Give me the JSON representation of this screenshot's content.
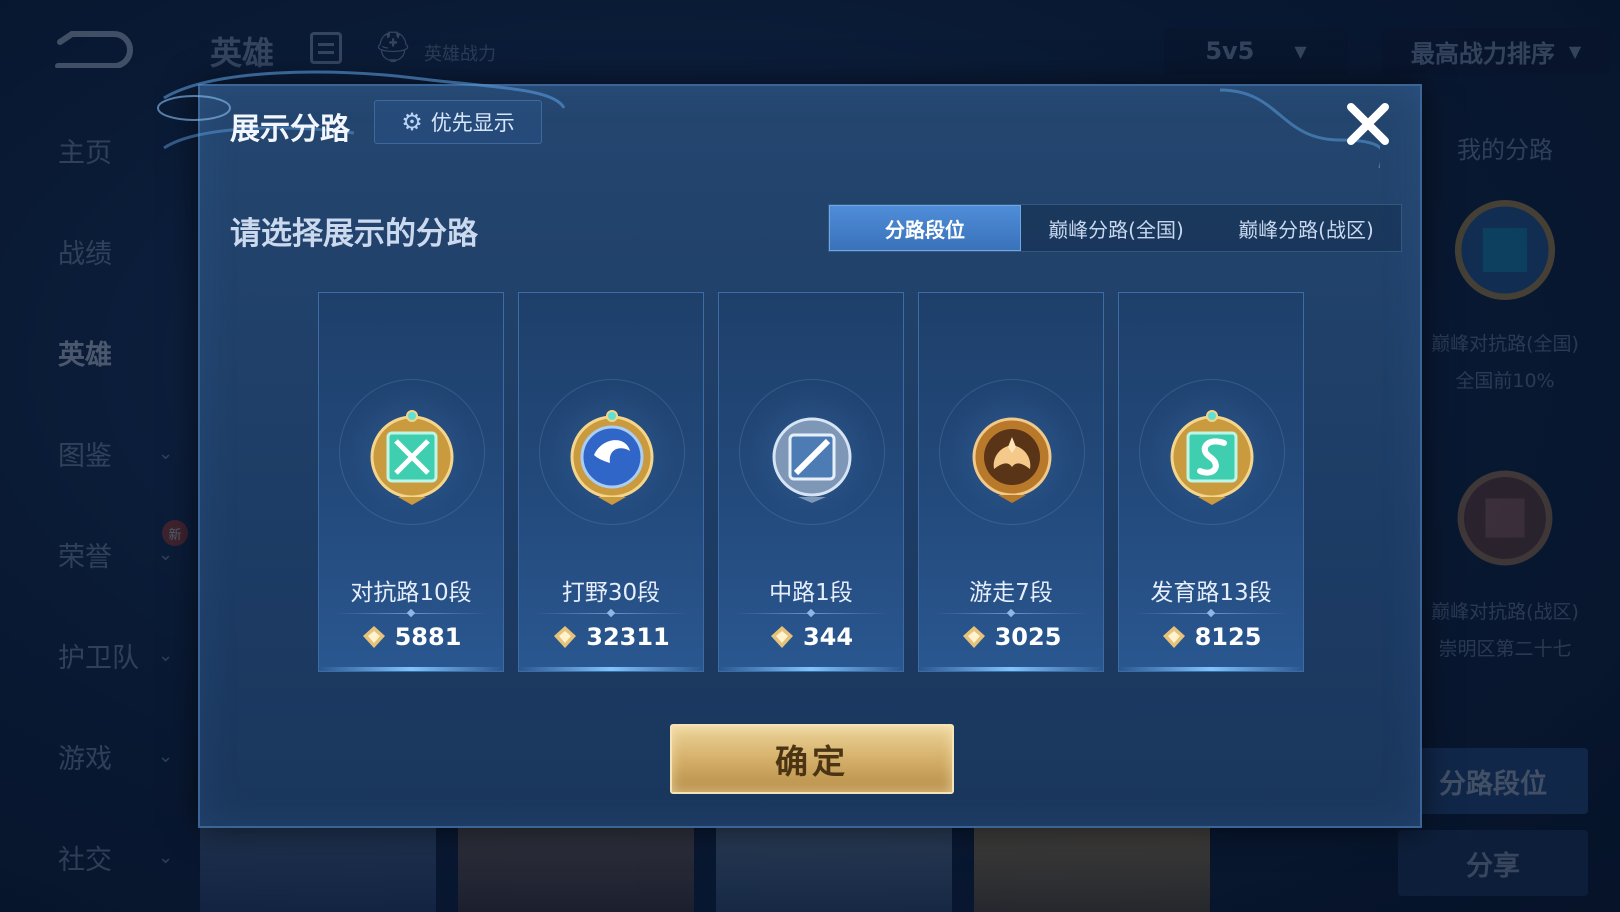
{
  "background": {
    "top_title": "英雄",
    "top_power_label": "英雄战力",
    "mode_select": "5v5",
    "sort_select": "最高战力排序",
    "sidebar": [
      {
        "label": "主页",
        "has_chevron": false
      },
      {
        "label": "战绩",
        "has_chevron": false
      },
      {
        "label": "英雄",
        "has_chevron": false,
        "active": true
      },
      {
        "label": "图鉴",
        "has_chevron": true
      },
      {
        "label": "荣誉",
        "has_chevron": true,
        "badge": "新"
      },
      {
        "label": "护卫队",
        "has_chevron": true
      },
      {
        "label": "游戏",
        "has_chevron": true
      },
      {
        "label": "社交",
        "has_chevron": true
      }
    ],
    "right_panel": {
      "title": "我的分路",
      "items": [
        {
          "label": "巅峰对抗路(全国)",
          "rank": "全国前10%"
        },
        {
          "label": "巅峰对抗路(战区)",
          "rank": "崇明区第二十七"
        }
      ],
      "seg_button": "分路段位",
      "share_button": "分享"
    }
  },
  "modal": {
    "title": "展示分路",
    "pref_button": "优先显示",
    "subtitle": "请选择展示的分路",
    "tabs": [
      {
        "label": "分路段位",
        "active": true
      },
      {
        "label": "巅峰分路(全国)",
        "active": false
      },
      {
        "label": "巅峰分路(战区)",
        "active": false
      }
    ],
    "cards": [
      {
        "label": "对抗路10段",
        "score": "5881",
        "emblem": "sword-shield-emblem-icon",
        "color": "#3fcfb0"
      },
      {
        "label": "打野30段",
        "score": "32311",
        "emblem": "dragon-emblem-icon",
        "color": "#2f66c8"
      },
      {
        "label": "中路1段",
        "score": "344",
        "emblem": "staff-emblem-icon",
        "color": "#9fb8d8"
      },
      {
        "label": "游走7段",
        "score": "3025",
        "emblem": "wings-emblem-icon",
        "color": "#c8862e"
      },
      {
        "label": "发育路13段",
        "score": "8125",
        "emblem": "arrow-emblem-icon",
        "color": "#3fcfb0"
      }
    ],
    "confirm_button": "确定"
  },
  "colors": {
    "accent_tab": "#4f8dd8",
    "gold_button": "#d5b06a",
    "modal_bg": "#1d3c65"
  }
}
